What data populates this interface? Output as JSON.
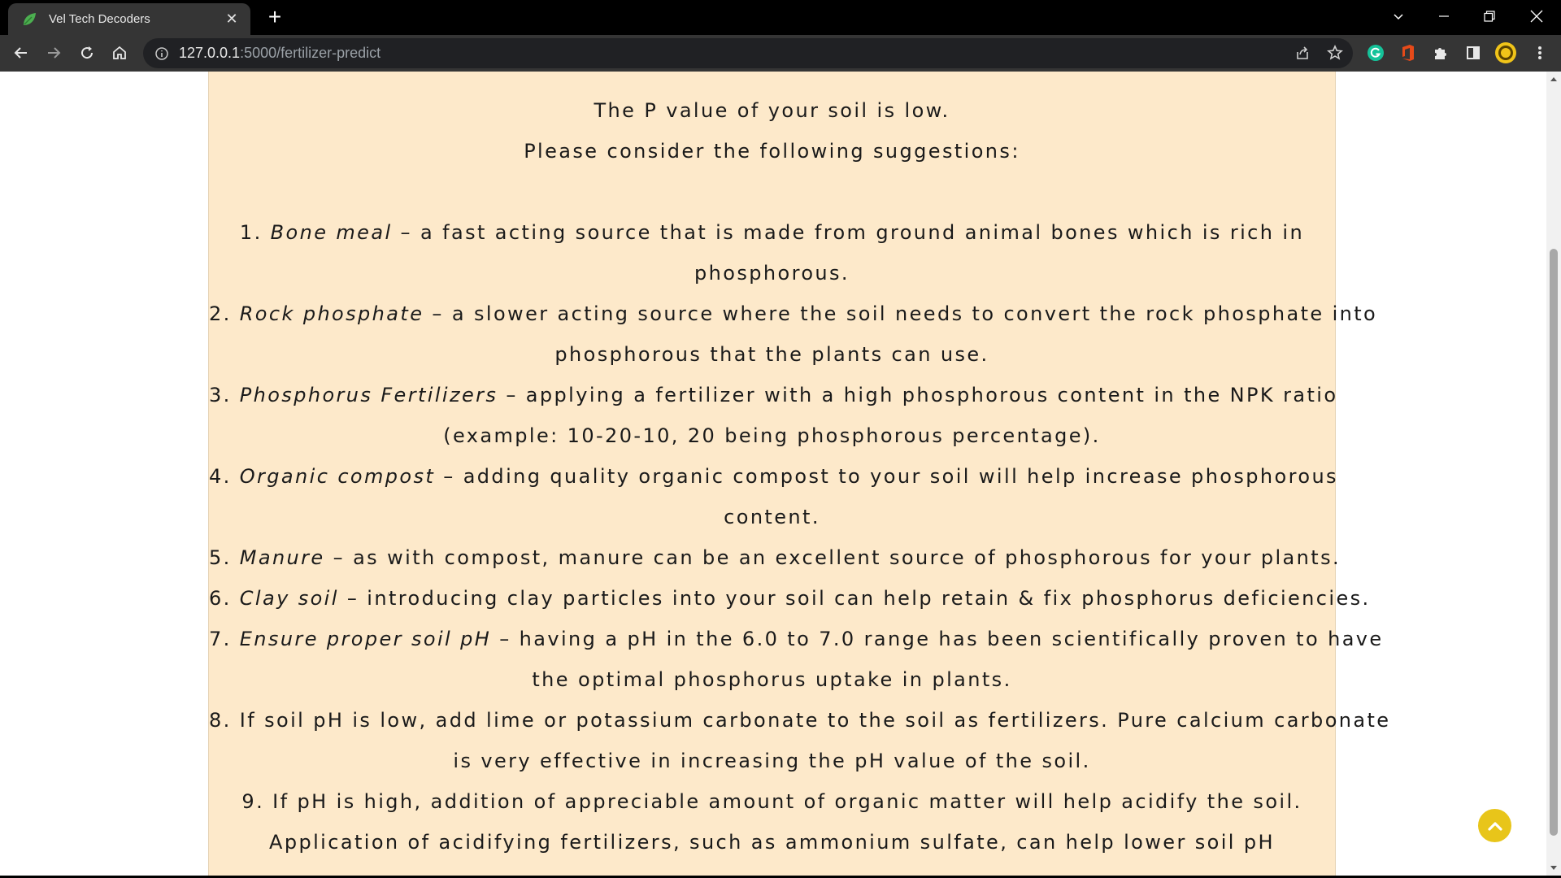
{
  "browser": {
    "tab_title": "Vel Tech Decoders",
    "tab_close": "✕",
    "new_tab": "+",
    "url_host": "127.0.0.1",
    "url_path": ":5000/fertilizer-predict",
    "icons": [
      "leaf-favicon-icon",
      "back-arrow-icon",
      "forward-arrow-icon",
      "reload-icon",
      "home-icon",
      "site-info-icon",
      "share-icon",
      "bookmark-star-icon",
      "grammarly-icon",
      "office-icon",
      "extensions-puzzle-icon",
      "side-panel-icon",
      "profile-avatar-icon",
      "menu-kebab-icon"
    ]
  },
  "page": {
    "intro": {
      "line1": "The P value of your soil is low.",
      "line2": "Please consider the following suggestions:"
    },
    "suggestions": [
      {
        "num": "1.",
        "term": "Bone meal",
        "rest": " – a fast acting source that is made from ground animal bones which is rich in",
        "cont": "phosphorous."
      },
      {
        "num": "2.",
        "term": "Rock phosphate",
        "rest": " – a slower acting source where the soil needs to convert the rock phosphate into",
        "cont": "phosphorous that the plants can use."
      },
      {
        "num": "3.",
        "term": "Phosphorus Fertilizers",
        "rest": " – applying a fertilizer with a high phosphorous content in the NPK ratio",
        "cont": "(example: 10-20-10, 20 being phosphorous percentage)."
      },
      {
        "num": "4.",
        "term": "Organic compost",
        "rest": " – adding quality organic compost to your soil will help increase phosphorous",
        "cont": "content."
      },
      {
        "num": "5.",
        "term": "Manure",
        "rest": " – as with compost, manure can be an excellent source of phosphorous for your plants."
      },
      {
        "num": "6.",
        "term": "Clay soil",
        "rest": " – introducing clay particles into your soil can help retain & fix phosphorus deficiencies."
      },
      {
        "num": "7.",
        "term": "Ensure proper soil pH",
        "rest": " – having a pH in the 6.0 to 7.0 range has been scientifically proven to have",
        "cont": "the optimal phosphorus uptake in plants."
      },
      {
        "num": "8.",
        "text": "If soil pH is low, add lime or potassium carbonate to the soil as fertilizers. Pure calcium carbonate",
        "cont": "is very effective in increasing the pH value of the soil."
      },
      {
        "num": "9.",
        "text": "If pH is high, addition of appreciable amount of organic matter will help acidify the soil.",
        "cont": "Application of acidifying fertilizers, such as ammonium sulfate, can help lower soil pH"
      }
    ]
  },
  "colors": {
    "card_bg": "#fde9ca",
    "to_top_button": "#e8c51a",
    "titlebar": "#000000",
    "toolbar": "#353535"
  }
}
